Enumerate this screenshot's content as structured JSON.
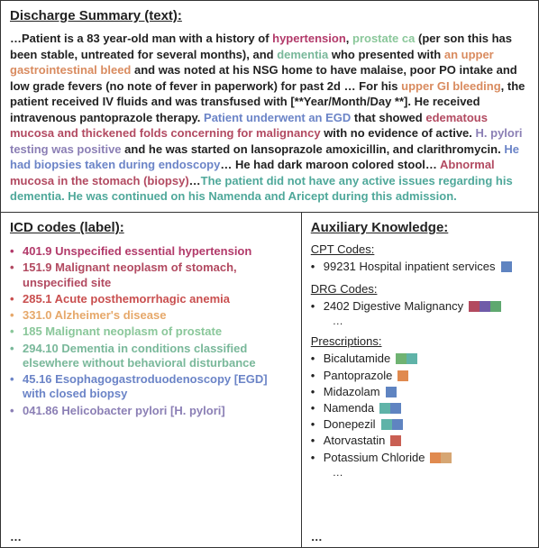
{
  "colors": {
    "hypertension": "#b23a6a",
    "prostate": "#8ac79a",
    "dementia": "#79b89a",
    "upperGI": "#d98b5f",
    "anemia": "#c94f4f",
    "alz": "#e6a86a",
    "egd_blue": "#6b84c7",
    "malignancy": "#b24a61",
    "hpylori": "#8b7fb5",
    "biopsy": "#6b84c7",
    "teal": "#4fa89a",
    "cpt_blue": "#5f84c1",
    "drg_red": "#b24a5f",
    "drg_purple": "#6f5ba8",
    "drg_green": "#5fa86f",
    "rx_green": "#6fb372",
    "rx_teal": "#5fb3a8",
    "rx_blue": "#5f84c1",
    "rx_orange": "#e08a4f",
    "rx_red": "#c95f53",
    "rx_tan": "#d6a673"
  },
  "top": {
    "title": "Discharge Summary (text):",
    "segments": [
      {
        "t": "…Patient is a 83 year-old man with a history of ",
        "c": "#222"
      },
      {
        "t": "hypertension",
        "c": "#b23a6a"
      },
      {
        "t": ", ",
        "c": "#222"
      },
      {
        "t": "prostate ca",
        "c": "#8ac79a"
      },
      {
        "t": " (per son this has been stable, untreated for several months), and ",
        "c": "#222"
      },
      {
        "t": "dementia",
        "c": "#79b89a"
      },
      {
        "t": " who presented with ",
        "c": "#222"
      },
      {
        "t": "an upper gastrointestinal bleed",
        "c": "#d98b5f"
      },
      {
        "t": " and was noted at his NSG home to have malaise, poor PO intake and low grade fevers (no note of fever in paperwork) for past 2d … For his ",
        "c": "#222"
      },
      {
        "t": "upper GI bleeding",
        "c": "#d98b5f"
      },
      {
        "t": ", the patient received IV fluids and was transfused with [**Year/Month/Day **]. He received intravenous pantoprazole therapy. ",
        "c": "#222"
      },
      {
        "t": "Patient underwent an EGD",
        "c": "#6b84c7"
      },
      {
        "t": " that showed ",
        "c": "#222"
      },
      {
        "t": "edematous mucosa and thickened folds concerning for malignancy",
        "c": "#b24a61"
      },
      {
        "t": " with no evidence of active. ",
        "c": "#222"
      },
      {
        "t": "H. pylori testing was positive",
        "c": "#8b7fb5"
      },
      {
        "t": " and he was started on lansoprazole  amoxicillin, and clarithromycin. ",
        "c": "#222"
      },
      {
        "t": "He had biopsies taken during endoscopy",
        "c": "#6b84c7"
      },
      {
        "t": "… He had dark maroon colored stool… ",
        "c": "#222"
      },
      {
        "t": "Abnormal mucosa in the stomach (biopsy)",
        "c": "#b24a61"
      },
      {
        "t": "…",
        "c": "#222"
      },
      {
        "t": "The patient did not have any active issues regarding his dementia. He was continued on his Namenda and Aricept during this admission.",
        "c": "#4fa89a"
      }
    ]
  },
  "icd": {
    "title": "ICD codes (label):",
    "items": [
      {
        "label": "401.9 Unspecified essential hypertension",
        "c": "#b23a6a"
      },
      {
        "label": "151.9 Malignant neoplasm of stomach, unspecified site",
        "c": "#b24a61"
      },
      {
        "label": "285.1 Acute posthemorrhagic anemia",
        "c": "#c94f4f"
      },
      {
        "label": "331.0 Alzheimer's disease",
        "c": "#e6a86a"
      },
      {
        "label": "185 Malignant neoplasm of prostate",
        "c": "#8ac79a"
      },
      {
        "label": "294.10 Dementia in conditions classified elsewhere without behavioral disturbance",
        "c": "#79b89a"
      },
      {
        "label": "45.16 Esophagogastroduodenoscopy [EGD] with closed biopsy",
        "c": "#6b84c7"
      },
      {
        "label": "041.86 Helicobacter pylori [H. pylori]",
        "c": "#8b7fb5"
      }
    ],
    "more": "…"
  },
  "aux": {
    "title": "Auxiliary Knowledge:",
    "cpt": {
      "heading": "CPT Codes:",
      "items": [
        {
          "label": "99231 Hospital inpatient services",
          "sw": [
            "#5f84c1"
          ]
        }
      ]
    },
    "drg": {
      "heading": "DRG Codes:",
      "items": [
        {
          "label": "2402 Digestive Malignancy",
          "sw": [
            "#b24a5f",
            "#6f5ba8",
            "#5fa86f"
          ]
        }
      ],
      "more": "…"
    },
    "rx": {
      "heading": "Prescriptions:",
      "items": [
        {
          "label": "Bicalutamide",
          "sw": [
            "#6fb372",
            "#5fb3a8"
          ]
        },
        {
          "label": "Pantoprazole",
          "sw": [
            "#e08a4f"
          ]
        },
        {
          "label": "Midazolam",
          "sw": [
            "#5f84c1"
          ]
        },
        {
          "label": "Namenda",
          "sw": [
            "#5fb3a8",
            "#5f84c1"
          ]
        },
        {
          "label": "Donepezil",
          "sw": [
            "#5fb3a8",
            "#5f84c1"
          ]
        },
        {
          "label": "Atorvastatin",
          "sw": [
            "#c95f53"
          ]
        },
        {
          "label": "Potassium Chloride",
          "sw": [
            "#e08a4f",
            "#d6a673"
          ]
        }
      ],
      "more": "…"
    }
  }
}
